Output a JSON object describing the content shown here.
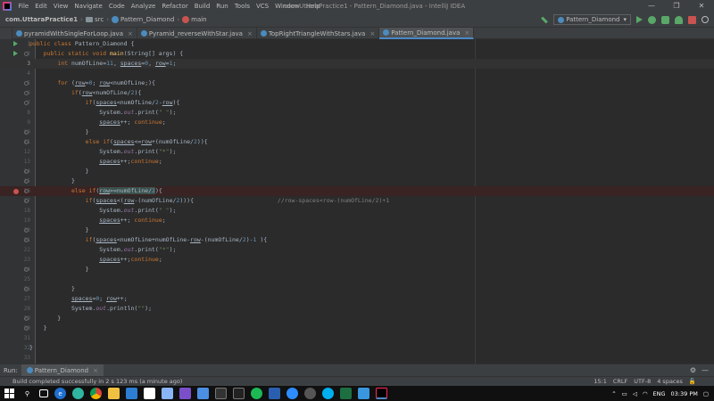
{
  "window": {
    "title": "com.UttaraPractice1 - Pattern_Diamond.java - IntelliJ IDEA",
    "menu": [
      "File",
      "Edit",
      "View",
      "Navigate",
      "Code",
      "Analyze",
      "Refactor",
      "Build",
      "Run",
      "Tools",
      "VCS",
      "Window",
      "Help"
    ],
    "controls": [
      "—",
      "❐",
      "✕"
    ]
  },
  "nav": {
    "crumbs": [
      "com.UttaraPractice1",
      "src",
      "Pattern_Diamond",
      "main"
    ],
    "run_config": "Pattern_Diamond"
  },
  "tabs": [
    {
      "label": "pyramidWithSingleForLoop.java"
    },
    {
      "label": "Pyramid_reverseWithStar.java"
    },
    {
      "label": "TopRightTriangleWithStars.java"
    },
    {
      "label": "Pattern_Diamond.java"
    }
  ],
  "editor": {
    "numbers": [
      "1",
      "2",
      "3",
      "4",
      "5",
      "6",
      "7",
      "8",
      "9",
      "10",
      "11",
      "12",
      "13",
      "14",
      "15",
      "16",
      "17",
      "18",
      "19",
      "20",
      "21",
      "22",
      "23",
      "24",
      "25",
      "26",
      "27",
      "28",
      "29",
      "30",
      "31",
      "32",
      "33"
    ],
    "comment_line17": "//row-spaces<row-(numOfLine/2)+1"
  },
  "run_panel": {
    "label": "Run:",
    "tab": "Pattern_Diamond",
    "icons": [
      "⚙",
      "—"
    ]
  },
  "status": {
    "message": "Build completed successfully in 2 s 123 ms (a minute ago)",
    "position": "15:1",
    "line_sep": "CRLF",
    "encoding": "UTF-8",
    "indent": "4 spaces"
  },
  "taskbar": {
    "lang": "ENG",
    "time": "03:39 PM"
  },
  "colors": {
    "keyword": "#cc7832",
    "method": "#ffc66d",
    "number": "#6897bb",
    "string": "#6a8759",
    "field": "#9876aa",
    "accent": "#4a88c7"
  }
}
